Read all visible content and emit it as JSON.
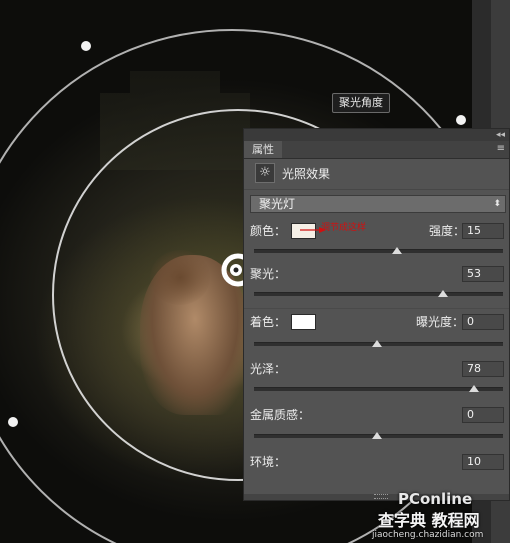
{
  "canvas": {
    "tooltip": "聚光角度"
  },
  "panel": {
    "tab_label": "属性",
    "collapse_icon": "double-chevron-left-icon",
    "menu_icon": "panel-menu-icon",
    "header_icon": "light-sun-icon",
    "header_title": "光照效果",
    "light_type": "聚光灯",
    "color_label": "颜色：",
    "color_value": "#f5efe6",
    "annotation": "调节成这样",
    "intensity_label": "强度：",
    "intensity": "15",
    "intensity_slider": 0.59,
    "hotspot_label": "聚光：",
    "hotspot": "53",
    "hotspot_slider": 0.76,
    "colorize_label": "着色：",
    "colorize_value": "#ffffff",
    "exposure_label": "曝光度：",
    "exposure": "0",
    "exposure_slider": 0.5,
    "gloss_label": "光泽：",
    "gloss": "78",
    "gloss_slider": 0.89,
    "metallic_label": "金属质感：",
    "metallic": "0",
    "metallic_slider": 0.5,
    "ambience_label": "环境：",
    "ambience": "10"
  },
  "watermark": {
    "logo": "PConline",
    "site": "查字典 教程网",
    "url": "jiaocheng.chazidian.com"
  }
}
